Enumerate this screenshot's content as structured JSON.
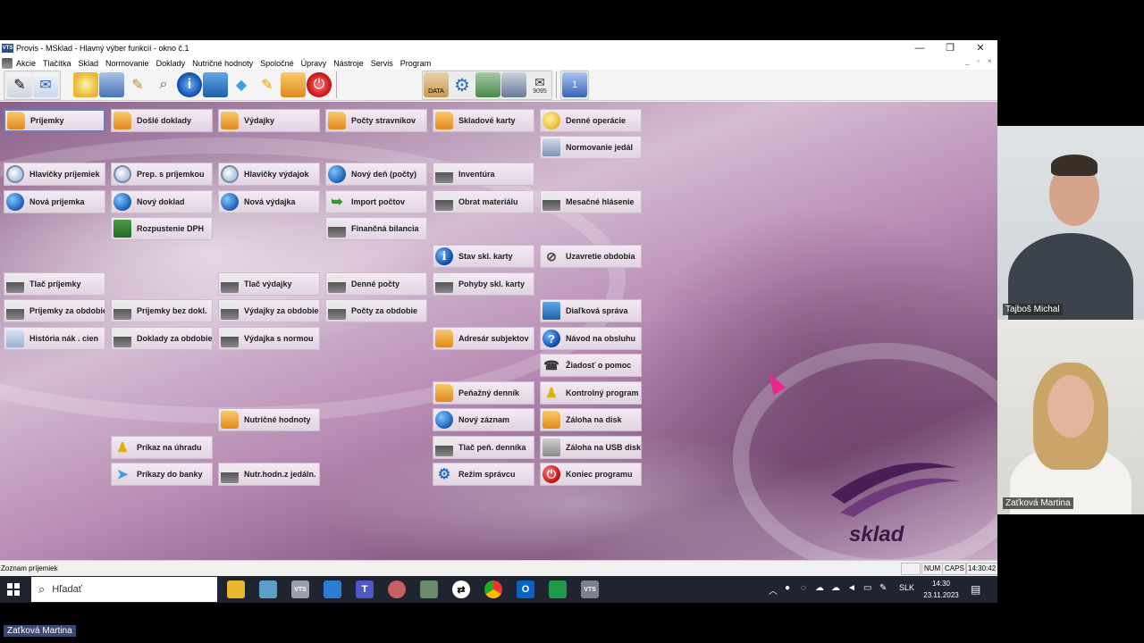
{
  "window": {
    "logo_text": "VTS",
    "title": "Provis - MSklad - Hlavný výber funkcií - okno č.1",
    "controls": [
      "—",
      "❐",
      "✕"
    ]
  },
  "menu": [
    "Akcie",
    "Tlačítka",
    "Sklad",
    "Normovanie",
    "Doklady",
    "Nutričné hodnoty",
    "Spoločné",
    "Úpravy",
    "Nástroje",
    "Servis",
    "Program"
  ],
  "toolbar": {
    "data_label": "DATA",
    "mail_count": "9095",
    "counter": "1"
  },
  "buttons": {
    "prijemky": "Príjemky",
    "dosle_doklady": "Došlé doklady",
    "vydajky": "Výdajky",
    "pocty_stravnikov": "Počty stravníkov",
    "skladove_karty": "Skladové karty",
    "denne_operacie": "Denné operácie",
    "normovanie_jedal": "Normovanie jedál",
    "hlavicky_prijemiek": "Hlavičky príjemiek",
    "prep_s_prijemkou": "Prep. s príjemkou",
    "hlavicky_vydajok": "Hlavičky výdajok",
    "novy_den_pocty": "Nový deň (počty)",
    "inventura": "Inventúra",
    "nova_prijemka": "Nová príjemka",
    "novy_doklad": "Nový doklad",
    "nova_vydajka": "Nová výdajka",
    "import_poctov": "Import počtov",
    "obrat_materialu": "Obrat materiálu",
    "mesacne_hlasenie": "Mesačné hlásenie",
    "rozpustenie_dph": "Rozpustenie DPH",
    "financna_bilancia": "Finančná bilancia",
    "stav_skl_karty": "Stav skl. karty",
    "uzavretie_obdobia": "Uzavretie obdobia",
    "tlac_prijemky": "Tlač príjemky",
    "tlac_vydajky": "Tlač výdajky",
    "denne_pocty": "Denné počty",
    "pohyby_skl_karty": "Pohyby skl. karty",
    "prijemky_za_obdobie": "Príjemky za obdobie",
    "prijemky_bez_dokl": "Príjemky bez dokl.",
    "vydajky_za_obdobie": "Výdajky za obdobie",
    "pocty_za_obdobie": "Počty za obdobie",
    "dialkova_sprava": "Diaľková správa",
    "historia_nak_cien": "História nák . cien",
    "doklady_za_obdobie": "Doklady za obdobie",
    "vydajka_s_normou": "Výdajka s normou",
    "adresar_subjektov": "Adresár subjektov",
    "navod_na_obsluhu": "Návod na obsluhu",
    "ziadost_o_pomoc": "Žiadosť o pomoc",
    "peniazny_dennik": "Peňažný denník",
    "kontrolny_program": "Kontrolný program",
    "nutricne_hodnoty": "Nutričné hodnoty",
    "novy_zaznam": "Nový záznam",
    "zaloha_na_disk": "Záloha na disk",
    "prikaz_na_uhradu": "Príkaz na úhradu",
    "tlac_pen_dennika": "Tlač peň. denníka",
    "zaloha_na_usb_disk": "Záloha na USB disk",
    "prikazy_do_banky": "Príkazy do banky",
    "nutr_hodn_z_jedaln": "Nutr.hodn.z jedáln.",
    "rezim_spravcu": "Režim správcu",
    "koniec_programu": "Koniec programu"
  },
  "brand": "sklad",
  "status": {
    "text": "Zoznam príjemiek",
    "num": "NUM",
    "caps": "CAPS",
    "time": "14:30:42"
  },
  "taskbar": {
    "search_placeholder": "Hľadať",
    "language": "SLK",
    "clock_time": "14:30",
    "clock_date": "23.11.2023"
  },
  "participants": {
    "p1": "Tajboš Michal",
    "p2": "Zaťková Martina",
    "bottom": "Zaťková Martina"
  },
  "colors": {
    "workspace_accent": "#8a5f88",
    "selected_border": "#6a7fb8",
    "cursor": "#e8278f"
  }
}
